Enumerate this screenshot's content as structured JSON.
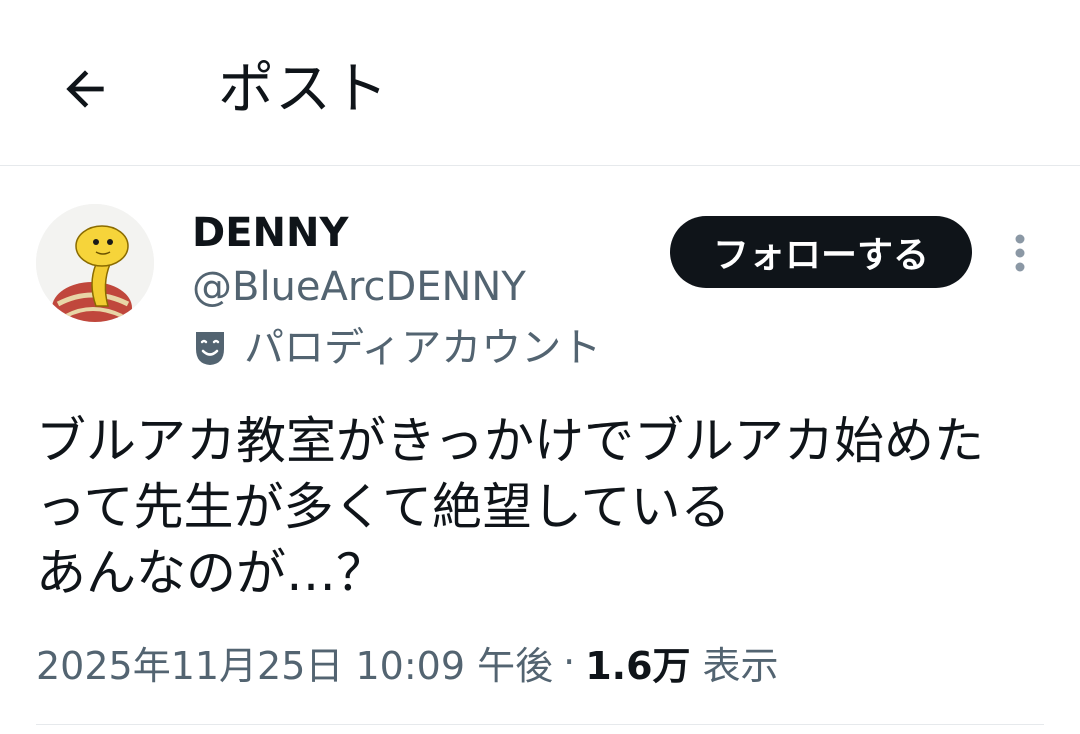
{
  "header": {
    "back_icon": "arrow-left-icon",
    "title": "ポスト"
  },
  "post": {
    "author": {
      "display_name": "DENNY",
      "handle": "@BlueArcDENNY",
      "parody_icon": "theater-mask-icon",
      "parody_label": "パロディアカウント"
    },
    "follow_label": "フォローする",
    "more_icon": "more-vertical-icon",
    "text_lines": [
      "ブルアカ教室がきっかけでブルアカ始めた",
      "って先生が多くて絶望している",
      "あんなのが…？"
    ],
    "meta": {
      "datetime": "2025年11月25日 10:09 午後",
      "separator": "·",
      "views_count": "1.6万",
      "views_label": "表示"
    }
  },
  "colors": {
    "text_primary": "#0f1419",
    "text_secondary": "#536471",
    "divider": "#e6e9ec",
    "follow_bg": "#0f1419",
    "follow_text": "#ffffff"
  }
}
